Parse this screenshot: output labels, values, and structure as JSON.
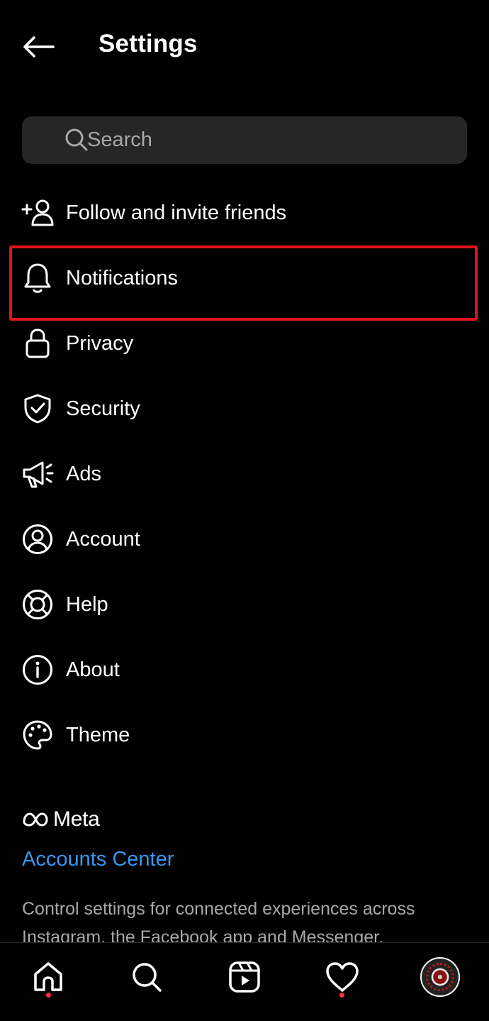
{
  "header": {
    "title": "Settings"
  },
  "search": {
    "placeholder": "Search"
  },
  "menu": [
    {
      "label": "Follow and invite friends",
      "icon": "add-person-icon"
    },
    {
      "label": "Notifications",
      "icon": "bell-icon",
      "highlighted": true
    },
    {
      "label": "Privacy",
      "icon": "lock-icon"
    },
    {
      "label": "Security",
      "icon": "shield-check-icon"
    },
    {
      "label": "Ads",
      "icon": "megaphone-icon"
    },
    {
      "label": "Account",
      "icon": "account-icon"
    },
    {
      "label": "Help",
      "icon": "lifebuoy-icon"
    },
    {
      "label": "About",
      "icon": "info-icon"
    },
    {
      "label": "Theme",
      "icon": "palette-icon"
    }
  ],
  "meta": {
    "brand": "Meta",
    "link": "Accounts Center",
    "description": "Control settings for connected experiences across Instagram, the Facebook app and Messenger."
  },
  "colors": {
    "highlight": "#e0141c",
    "link": "#3797f0",
    "dot": "#ff3040",
    "search_bg": "#262626"
  }
}
